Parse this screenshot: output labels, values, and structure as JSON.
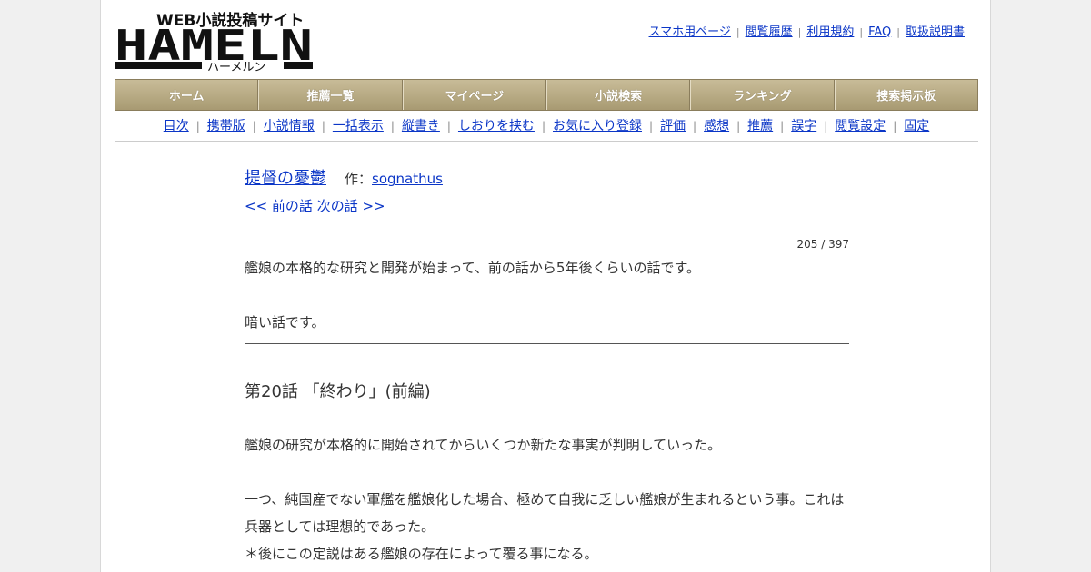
{
  "logo": {
    "main": "HAMELN",
    "sub": "WEB小説投稿サイト",
    "kana": "ハーメルン"
  },
  "toplinks": [
    "スマホ用ページ",
    "閲覧履歴",
    "利用規約",
    "FAQ",
    "取扱説明書"
  ],
  "mainnav": [
    "ホーム",
    "推薦一覧",
    "マイページ",
    "小説検索",
    "ランキング",
    "捜索掲示板"
  ],
  "subnav": [
    "目次",
    "携帯版",
    "小説情報",
    "一括表示",
    "縦書き",
    "しおりを挟む",
    "お気に入り登録",
    "評価",
    "感想",
    "推薦",
    "誤字",
    "閲覧設定",
    "固定"
  ],
  "novel": {
    "title": "提督の憂鬱",
    "author_label": "作：",
    "author": "sognathus",
    "prev": "<< 前の話",
    "next": "次の話 >>",
    "counter": "205 / 397"
  },
  "preface": [
    "艦娘の本格的な研究と開発が始まって、前の話から5年後くらいの話です。",
    "暗い話です。"
  ],
  "chapter_title": "第20話 「終わり」(前編)",
  "body": [
    "艦娘の研究が本格的に開始されてからいくつか新たな事実が判明していった。",
    "一つ、純国産でない軍艦を艦娘化した場合、極めて自我に乏しい艦娘が生まれるという事。これは",
    "兵器としては理想的であった。",
    "＊後にこの定説はある艦娘の存在によって覆る事になる。"
  ]
}
